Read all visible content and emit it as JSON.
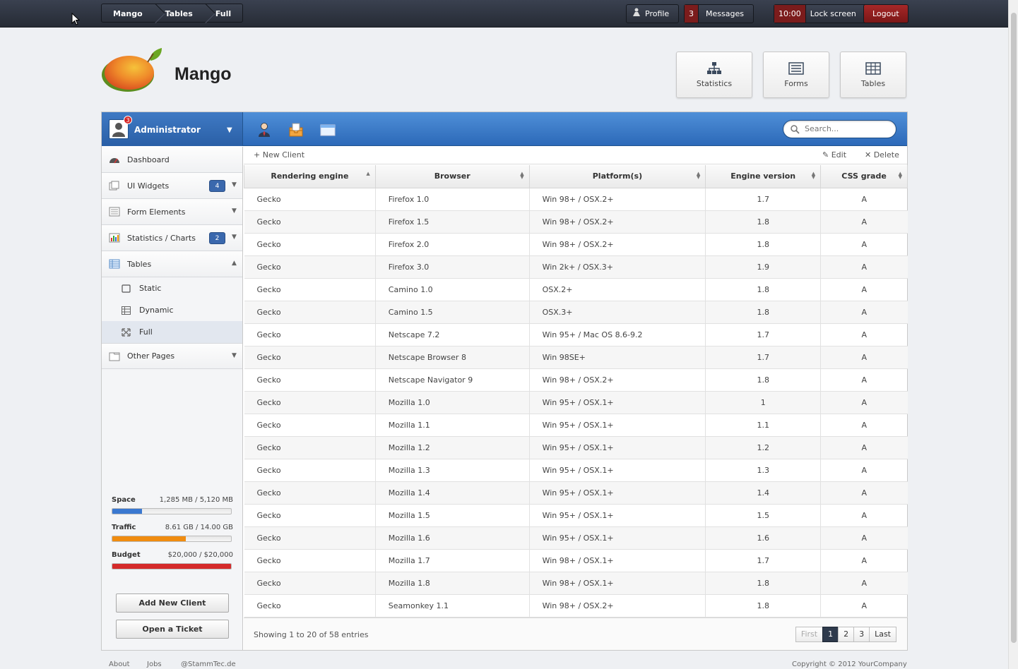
{
  "topbar": {
    "breadcrumbs": [
      "Mango",
      "Tables",
      "Full"
    ],
    "profile_label": "Profile",
    "messages_count": "3",
    "messages_label": "Messages",
    "lock_time": "10:00",
    "lock_label": "Lock screen",
    "logout_label": "Logout"
  },
  "header": {
    "logo_text": "Mango",
    "nav": [
      {
        "label": "Statistics",
        "icon": "sitemap-icon"
      },
      {
        "label": "Forms",
        "icon": "list-icon"
      },
      {
        "label": "Tables",
        "icon": "table-icon"
      }
    ]
  },
  "bluebar": {
    "user_name": "Administrator",
    "notification_count": "3",
    "search_placeholder": "Search..."
  },
  "sidebar": {
    "items": [
      {
        "label": "Dashboard",
        "icon": "dashboard-icon"
      },
      {
        "label": "UI Widgets",
        "icon": "widgets-icon",
        "count": "4"
      },
      {
        "label": "Form Elements",
        "icon": "form-icon"
      },
      {
        "label": "Statistics / Charts",
        "icon": "chart-icon",
        "count": "2"
      },
      {
        "label": "Tables",
        "icon": "table-icon"
      }
    ],
    "sub_items": [
      {
        "label": "Static",
        "icon": "square-icon"
      },
      {
        "label": "Dynamic",
        "icon": "grid-icon"
      },
      {
        "label": "Full",
        "icon": "expand-icon"
      }
    ],
    "other": {
      "label": "Other Pages",
      "icon": "page-icon"
    },
    "stats": [
      {
        "label": "Space",
        "value": "1,285 MB / 5,120 MB",
        "fraction": 0.25,
        "color": "#3a78d0"
      },
      {
        "label": "Traffic",
        "value": "8.61 GB / 14.00 GB",
        "fraction": 0.62,
        "color": "#f08c10"
      },
      {
        "label": "Budget",
        "value": "$20,000 / $20,000",
        "fraction": 1.0,
        "color": "#d42a2a"
      }
    ],
    "add_client_label": "Add New Client",
    "ticket_label": "Open a Ticket"
  },
  "toolbar": {
    "new_label": "+ New Client",
    "edit_label": "✎ Edit",
    "delete_label": "✕ Delete"
  },
  "table": {
    "columns": [
      "Rendering engine",
      "Browser",
      "Platform(s)",
      "Engine version",
      "CSS grade"
    ],
    "rows": [
      [
        "Gecko",
        "Firefox 1.0",
        "Win 98+ / OSX.2+",
        "1.7",
        "A"
      ],
      [
        "Gecko",
        "Firefox 1.5",
        "Win 98+ / OSX.2+",
        "1.8",
        "A"
      ],
      [
        "Gecko",
        "Firefox 2.0",
        "Win 98+ / OSX.2+",
        "1.8",
        "A"
      ],
      [
        "Gecko",
        "Firefox 3.0",
        "Win 2k+ / OSX.3+",
        "1.9",
        "A"
      ],
      [
        "Gecko",
        "Camino 1.0",
        "OSX.2+",
        "1.8",
        "A"
      ],
      [
        "Gecko",
        "Camino 1.5",
        "OSX.3+",
        "1.8",
        "A"
      ],
      [
        "Gecko",
        "Netscape 7.2",
        "Win 95+ / Mac OS 8.6-9.2",
        "1.7",
        "A"
      ],
      [
        "Gecko",
        "Netscape Browser 8",
        "Win 98SE+",
        "1.7",
        "A"
      ],
      [
        "Gecko",
        "Netscape Navigator 9",
        "Win 98+ / OSX.2+",
        "1.8",
        "A"
      ],
      [
        "Gecko",
        "Mozilla 1.0",
        "Win 95+ / OSX.1+",
        "1",
        "A"
      ],
      [
        "Gecko",
        "Mozilla 1.1",
        "Win 95+ / OSX.1+",
        "1.1",
        "A"
      ],
      [
        "Gecko",
        "Mozilla 1.2",
        "Win 95+ / OSX.1+",
        "1.2",
        "A"
      ],
      [
        "Gecko",
        "Mozilla 1.3",
        "Win 95+ / OSX.1+",
        "1.3",
        "A"
      ],
      [
        "Gecko",
        "Mozilla 1.4",
        "Win 95+ / OSX.1+",
        "1.4",
        "A"
      ],
      [
        "Gecko",
        "Mozilla 1.5",
        "Win 95+ / OSX.1+",
        "1.5",
        "A"
      ],
      [
        "Gecko",
        "Mozilla 1.6",
        "Win 95+ / OSX.1+",
        "1.6",
        "A"
      ],
      [
        "Gecko",
        "Mozilla 1.7",
        "Win 98+ / OSX.1+",
        "1.7",
        "A"
      ],
      [
        "Gecko",
        "Mozilla 1.8",
        "Win 98+ / OSX.1+",
        "1.8",
        "A"
      ],
      [
        "Gecko",
        "Seamonkey 1.1",
        "Win 98+ / OSX.2+",
        "1.8",
        "A"
      ]
    ],
    "info": "Showing 1 to 20 of 58 entries",
    "pager": [
      "First",
      "1",
      "2",
      "3",
      "Last"
    ]
  },
  "footer": {
    "links": [
      "About",
      "Jobs",
      "@StammTec.de"
    ],
    "copyright": "Copyright © 2012 YourCompany"
  }
}
